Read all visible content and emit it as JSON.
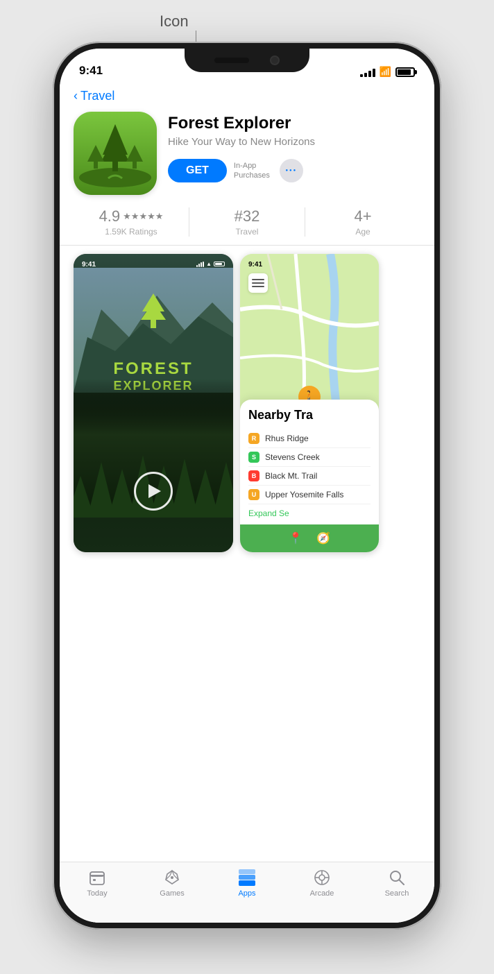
{
  "annotation": {
    "label": "Icon",
    "line_visible": true
  },
  "phone": {
    "status_bar": {
      "time": "9:41",
      "signal_bars": [
        4,
        6,
        8,
        10,
        12
      ],
      "wifi": "wifi",
      "battery": 85
    },
    "back_nav": {
      "text": "Travel",
      "chevron": "‹"
    },
    "app_header": {
      "name": "Forest Explorer",
      "subtitle": "Hike Your Way to New Horizons",
      "get_button_label": "GET",
      "in_app_text": "In-App\nPurchases",
      "more_icon": "•••"
    },
    "ratings": {
      "score": "4.9",
      "stars": "★★★★★",
      "ratings_count": "1.59K Ratings",
      "rank": "#32",
      "rank_category": "Travel",
      "age": "4+",
      "age_label": "Age"
    },
    "screenshots": {
      "ss1": {
        "status_time": "9:41",
        "title_line1": "FOREST",
        "title_line2": "EXPLORER"
      },
      "ss2": {
        "status_time": "9:41",
        "nearby_title": "Nearby Tra",
        "trails": [
          {
            "name": "Rhus Ridge",
            "color": "#f5a623",
            "letter": "R"
          },
          {
            "name": "Stevens Creek",
            "color": "#34c759",
            "letter": "S"
          },
          {
            "name": "Black Mt. Trail",
            "color": "#ff3b30",
            "letter": "B"
          },
          {
            "name": "Upper Yosemite Falls",
            "color": "#f5a623",
            "letter": "U"
          }
        ],
        "expand_text": "Expand Se"
      }
    },
    "tab_bar": {
      "tabs": [
        {
          "id": "today",
          "label": "Today",
          "active": false
        },
        {
          "id": "games",
          "label": "Games",
          "active": false
        },
        {
          "id": "apps",
          "label": "Apps",
          "active": true
        },
        {
          "id": "arcade",
          "label": "Arcade",
          "active": false
        },
        {
          "id": "search",
          "label": "Search",
          "active": false
        }
      ]
    }
  }
}
